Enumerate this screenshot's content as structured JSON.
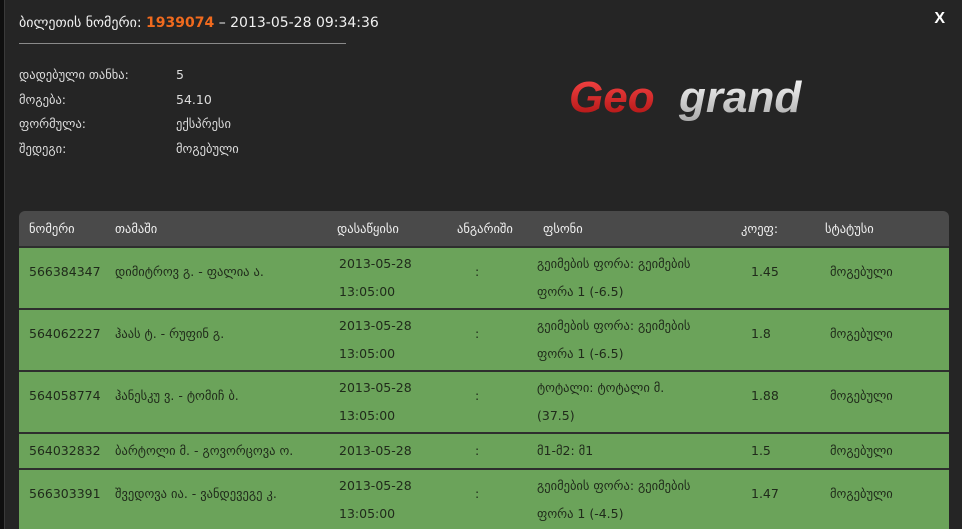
{
  "header": {
    "ticket_label": "ბილეთის ნომერი:",
    "ticket_number": "1939074",
    "ticket_datetime": "– 2013-05-28 09:34:36",
    "close_label": "X"
  },
  "info": [
    {
      "label": "დადებული თანხა:",
      "value": "5"
    },
    {
      "label": "მოგება:",
      "value": "54.10"
    },
    {
      "label": "ფორმულა:",
      "value": "ექსპრესი"
    },
    {
      "label": "შედეგი:",
      "value": "მოგებული"
    }
  ],
  "logo": {
    "part1": "Geo",
    "part2": "grand",
    "color1": "#d21f1f",
    "color2": "#e8e8e8"
  },
  "table": {
    "headers": [
      "ნომერი",
      "თამაში",
      "დასაწყისი",
      "ანგარიში",
      "ფსონი",
      "კოეფ:",
      "სტატუსი"
    ],
    "rows": [
      {
        "id": "566384347",
        "game": "დიმიტროვ გ. - ფალია ა.",
        "date": "2013-05-28",
        "time": "13:05:00",
        "score": ":",
        "bet_line1": "გეიმების ფორა: გეიმების",
        "bet_line2": "ფორა 1 (-6.5)",
        "coef": "1.45",
        "status": "მოგებული"
      },
      {
        "id": "564062227",
        "game": "ჰაას ტ. - რუფინ გ.",
        "date": "2013-05-28",
        "time": "13:05:00",
        "score": ":",
        "bet_line1": "გეიმების ფორა: გეიმების",
        "bet_line2": "ფორა 1 (-6.5)",
        "coef": "1.8",
        "status": "მოგებული"
      },
      {
        "id": "564058774",
        "game": "ჰანესკუ ვ. - ტომიჩ ბ.",
        "date": "2013-05-28",
        "time": "13:05:00",
        "score": ":",
        "bet_line1": "ტოტალი: ტოტალი მ.",
        "bet_line2": "(37.5)",
        "coef": "1.88",
        "status": "მოგებული"
      },
      {
        "id": "564032832",
        "game": "ბარტოლი მ. - გოვორცოვა ო.",
        "date": "2013-05-28",
        "time": "",
        "score": ":",
        "bet_line1": "მ1-მ2: მ1",
        "bet_line2": "",
        "coef": "1.5",
        "status": "მოგებული"
      },
      {
        "id": "566303391",
        "game": "შვედოვა ია. - ვანდევეგე კ.",
        "date": "2013-05-28",
        "time": "13:05:00",
        "score": ":",
        "bet_line1": "გეიმების ფორა: გეიმების",
        "bet_line2": "ფორა 1 (-4.5)",
        "coef": "1.47",
        "status": "მოგებული"
      }
    ],
    "row_color": "#6ba35a",
    "header_color": "#4a4a4a"
  }
}
